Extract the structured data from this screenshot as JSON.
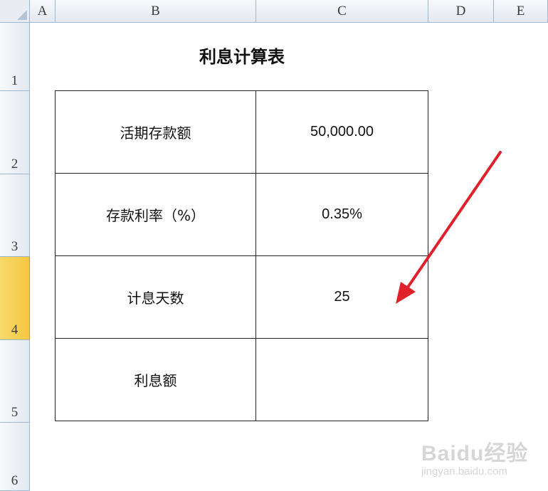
{
  "columns": [
    "A",
    "B",
    "C",
    "D",
    "E"
  ],
  "rows": [
    "1",
    "2",
    "3",
    "4",
    "5",
    "6"
  ],
  "active_row": "4",
  "title": "利息计算表",
  "table": [
    {
      "label": "活期存款额",
      "value": "50,000.00"
    },
    {
      "label": "存款利率（%）",
      "value": "0.35%"
    },
    {
      "label": "计息天数",
      "value": "25"
    },
    {
      "label": "利息额",
      "value": ""
    }
  ],
  "annotation": {
    "type": "red-arrow",
    "color": "#e0202a"
  },
  "watermark": {
    "logo": "Baidu经验",
    "url": "jingyan.baidu.com"
  },
  "colors": {
    "header_bg": "#e4e9f0",
    "active_row_bg": "#f5c842",
    "grid_border": "#222222"
  }
}
